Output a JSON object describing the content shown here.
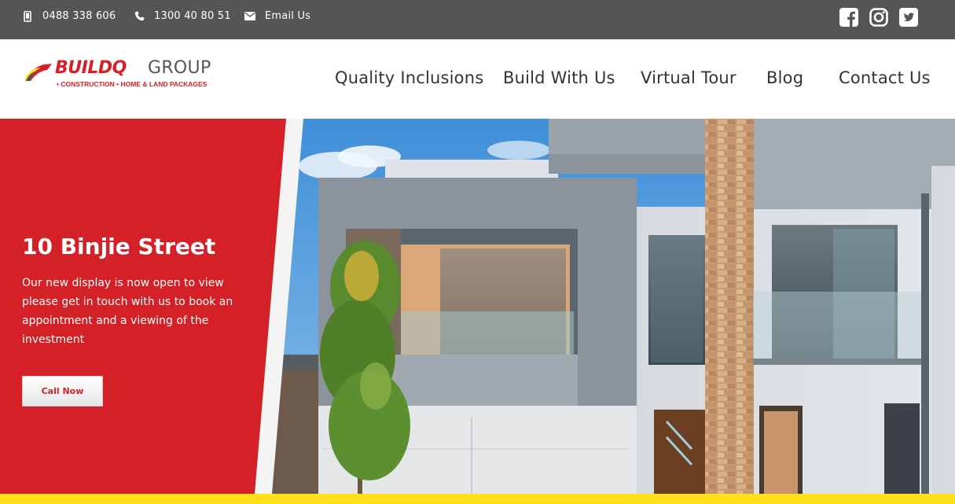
{
  "colors": {
    "topbar": "#555555",
    "brand_red": "#d42027",
    "accent_yellow": "#ffe01b",
    "nav_text": "#333333"
  },
  "topbar": {
    "mobile": {
      "icon": "mobile-icon",
      "text": "0488 338 606"
    },
    "phone": {
      "icon": "phone-icon",
      "text": "1300 40 80 51"
    },
    "email": {
      "icon": "envelope-icon",
      "text": "Email Us"
    },
    "social": [
      "facebook-icon",
      "instagram-icon",
      "twitter-icon"
    ]
  },
  "logo": {
    "brand": "BUILDQ",
    "group": "GROUP",
    "tagline": "• CONSTRUCTION • HOME & LAND PACKAGES"
  },
  "nav": {
    "items": [
      "Quality Inclusions",
      "Build With Us",
      "Virtual Tour",
      "Blog",
      "Contact Us"
    ]
  },
  "hero": {
    "title": "10 Binjie Street",
    "text": "Our new display is now open to view please get in touch with us to book an appointment and a viewing of the investment",
    "cta_label": "Call Now"
  }
}
